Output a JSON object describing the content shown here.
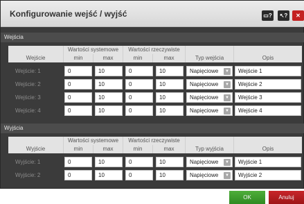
{
  "dialog": {
    "title": "Konfigurowanie wejść / wyjść"
  },
  "title_buttons": [
    {
      "icon": "window-icon",
      "glyph": "▭?"
    },
    {
      "icon": "help-cursor-icon",
      "glyph": "↖?"
    },
    {
      "icon": "close-icon",
      "glyph": "✕"
    }
  ],
  "inputs": {
    "section_title": "Wejścia",
    "header": {
      "system_values": "Wartości systemowe",
      "real_values": "Wartości rzeczywiste",
      "col_name": "Wejście",
      "min": "min",
      "max": "max",
      "type": "Typ wejścia",
      "description": "Opis"
    },
    "rows": [
      {
        "label": "Wejście: 1",
        "sys_min": "0",
        "sys_max": "10",
        "real_min": "0",
        "real_max": "10",
        "type": "Napięciowe",
        "desc": "Wejście 1"
      },
      {
        "label": "Wejście: 2",
        "sys_min": "0",
        "sys_max": "10",
        "real_min": "0",
        "real_max": "10",
        "type": "Napięciowe",
        "desc": "Wejście 2"
      },
      {
        "label": "Wejście: 3",
        "sys_min": "0",
        "sys_max": "10",
        "real_min": "0",
        "real_max": "10",
        "type": "Napięciowe",
        "desc": "Wejście 3"
      },
      {
        "label": "Wejście: 4",
        "sys_min": "0",
        "sys_max": "10",
        "real_min": "0",
        "real_max": "10",
        "type": "Napięciowe",
        "desc": "Wejście 4"
      }
    ]
  },
  "outputs": {
    "section_title": "Wyjścia",
    "header": {
      "system_values": "Wartości systemowe",
      "real_values": "Wartości rzeczywiste",
      "col_name": "Wyjście",
      "min": "min",
      "max": "max",
      "type": "Typ wyjścia",
      "description": "Opis"
    },
    "rows": [
      {
        "label": "Wyjście: 1",
        "sys_min": "0",
        "sys_max": "10",
        "real_min": "0",
        "real_max": "10",
        "type": "Napięciowe",
        "desc": "Wyjście 1"
      },
      {
        "label": "Wyjście: 2",
        "sys_min": "0",
        "sys_max": "10",
        "real_min": "0",
        "real_max": "10",
        "type": "Napięciowe",
        "desc": "Wyjście 2"
      }
    ]
  },
  "footer": {
    "ok_label": "OK",
    "cancel_label": "Anuluj"
  },
  "colors": {
    "ok": "#3b9a2c",
    "cancel": "#b51d21",
    "panel": "#3b3b3b"
  }
}
